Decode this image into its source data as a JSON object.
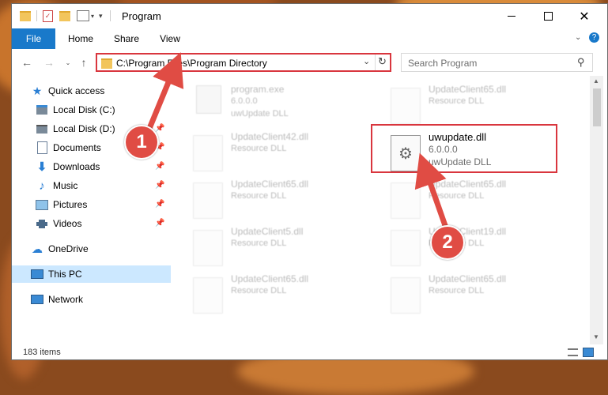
{
  "window": {
    "title": "Program"
  },
  "ribbon": {
    "tabs": [
      "File",
      "Home",
      "Share",
      "View"
    ]
  },
  "address": {
    "path": "C:\\Program Files\\Program Directory"
  },
  "search": {
    "placeholder": "Search Program"
  },
  "sidebar": {
    "items": [
      {
        "label": "Quick access",
        "icon": "star-icon",
        "pinned": false
      },
      {
        "label": "Local Disk (C:)",
        "icon": "drive-icon",
        "pinned": false
      },
      {
        "label": "Local Disk (D:)",
        "icon": "drive-icon",
        "pinned": true
      },
      {
        "label": "Documents",
        "icon": "documents-icon",
        "pinned": true
      },
      {
        "label": "Downloads",
        "icon": "download-icon",
        "pinned": true
      },
      {
        "label": "Music",
        "icon": "music-icon",
        "pinned": true
      },
      {
        "label": "Pictures",
        "icon": "pictures-icon",
        "pinned": true
      },
      {
        "label": "Videos",
        "icon": "videos-icon",
        "pinned": true
      },
      {
        "label": "OneDrive",
        "icon": "cloud-icon",
        "pinned": false
      },
      {
        "label": "This PC",
        "icon": "computer-icon",
        "pinned": false,
        "selected": true
      },
      {
        "label": "Network",
        "icon": "network-icon",
        "pinned": false
      }
    ]
  },
  "files": [
    {
      "name": "program.exe",
      "line2": "6.0.0.0",
      "line3": "uwUpdate DLL",
      "type": "exe"
    },
    {
      "name": "UpdateClient65.dll",
      "line2": "Resource DLL",
      "line3": "",
      "type": "dll"
    },
    {
      "name": "UpdateClient42.dll",
      "line2": "Resource DLL",
      "line3": "",
      "type": "dll"
    },
    {
      "name": "uwupdate.dll",
      "line2": "6.0.0.0",
      "line3": "uwUpdate DLL",
      "type": "dll",
      "highlighted": true
    },
    {
      "name": "UpdateClient65.dll",
      "line2": "Resource DLL",
      "line3": "",
      "type": "dll"
    },
    {
      "name": "UpdateClient65.dll",
      "line2": "Resource DLL",
      "line3": "",
      "type": "dll"
    },
    {
      "name": "UpdateClient5.dll",
      "line2": "Resource DLL",
      "line3": "",
      "type": "dll"
    },
    {
      "name": "UpdateClient19.dll",
      "line2": "Resource DLL",
      "line3": "",
      "type": "dll"
    },
    {
      "name": "UpdateClient65.dll",
      "line2": "Resource DLL",
      "line3": "",
      "type": "dll"
    },
    {
      "name": "UpdateClient65.dll",
      "line2": "Resource DLL",
      "line3": "",
      "type": "dll"
    }
  ],
  "status": {
    "item_count": "183 items"
  },
  "annotations": {
    "badge1": "1",
    "badge2": "2",
    "color": "#d9363e"
  }
}
